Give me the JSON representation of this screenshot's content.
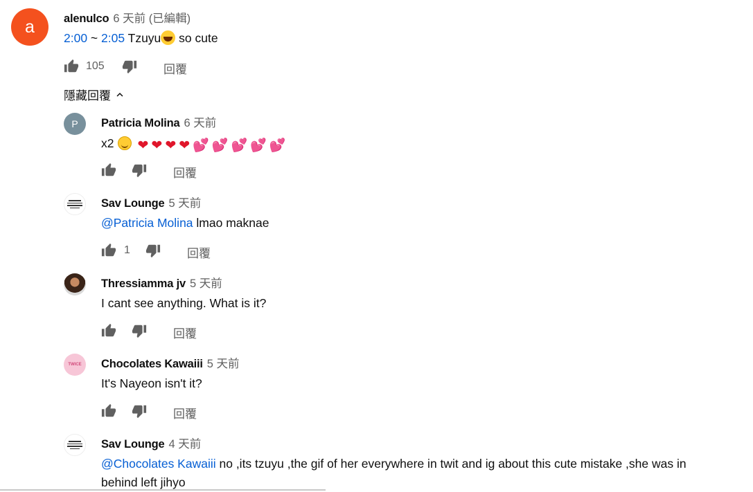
{
  "thread": {
    "comment": {
      "avatar_letter": "a",
      "author": "alenulco",
      "time": "6 天前 (已編輯)",
      "ts_start": "2:00",
      "ts_sep": " ~ ",
      "ts_end": "2:05",
      "text_a": " Tzuyu",
      "emoji": "laughing-emoji",
      "text_b": " so cute",
      "likes": "105",
      "reply_label": "回覆"
    },
    "hide_replies_label": "隱藏回覆",
    "replies": [
      {
        "avatar_letter": "P",
        "author": "Patricia Molina",
        "time": "6 天前",
        "text": "x2",
        "hearts": [
          "❤",
          "❤",
          "❤",
          "❤",
          "💕",
          "💕",
          "💕",
          "💕",
          "💕"
        ],
        "reply_label": "回覆"
      },
      {
        "author": "Sav Lounge",
        "time": "5 天前",
        "mention": "@Patricia Molina",
        "text": " lmao maknae",
        "likes": "1",
        "reply_label": "回覆"
      },
      {
        "author": "Thressiamma jv",
        "time": "5 天前",
        "text": "I cant see anything. What is it?",
        "reply_label": "回覆"
      },
      {
        "author": "Chocolates Kawaiii",
        "avatar_text": "TWICE",
        "time": "5 天前",
        "text": "It's Nayeon isn't it?",
        "reply_label": "回覆"
      },
      {
        "author": "Sav Lounge",
        "time": "4 天前",
        "mention": "@Chocolates Kawaiii",
        "text": " no ,its tzuyu ,the gif of her everywhere in twit and ig about this cute mistake ,she was in",
        "text_line2": "behind left jihyo"
      }
    ]
  },
  "icons": {
    "like": "thumbs-up-icon",
    "dislike": "thumbs-down-icon",
    "chevron": "chevron-up-icon"
  },
  "colors": {
    "link": "#065fd4",
    "avatar_main": "#f4511e",
    "avatar_p": "#78909c"
  }
}
